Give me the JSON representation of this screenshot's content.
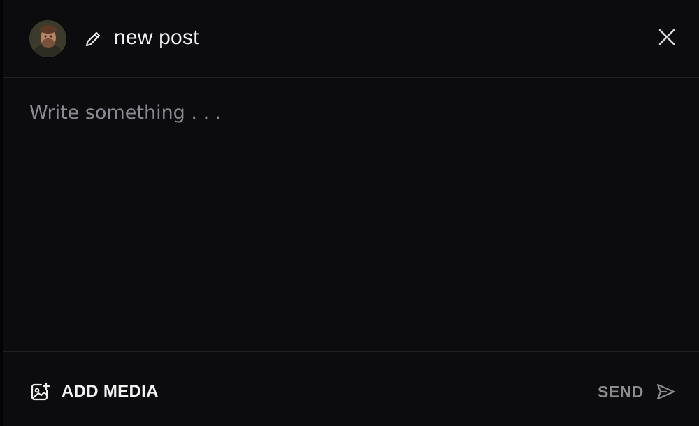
{
  "header": {
    "title": "new post",
    "avatar_icon": "user-avatar-photo",
    "edit_icon": "pencil-icon",
    "close_icon": "close-icon"
  },
  "composer": {
    "placeholder": "Write something . . .",
    "value": ""
  },
  "footer": {
    "add_media_label": "ADD MEDIA",
    "add_media_icon": "image-add-icon",
    "send_label": "SEND",
    "send_icon": "send-icon"
  },
  "colors": {
    "background": "#0c0b0d",
    "divider": "#222226",
    "text_primary": "#f4f4f4",
    "text_muted": "#8a8a92"
  }
}
